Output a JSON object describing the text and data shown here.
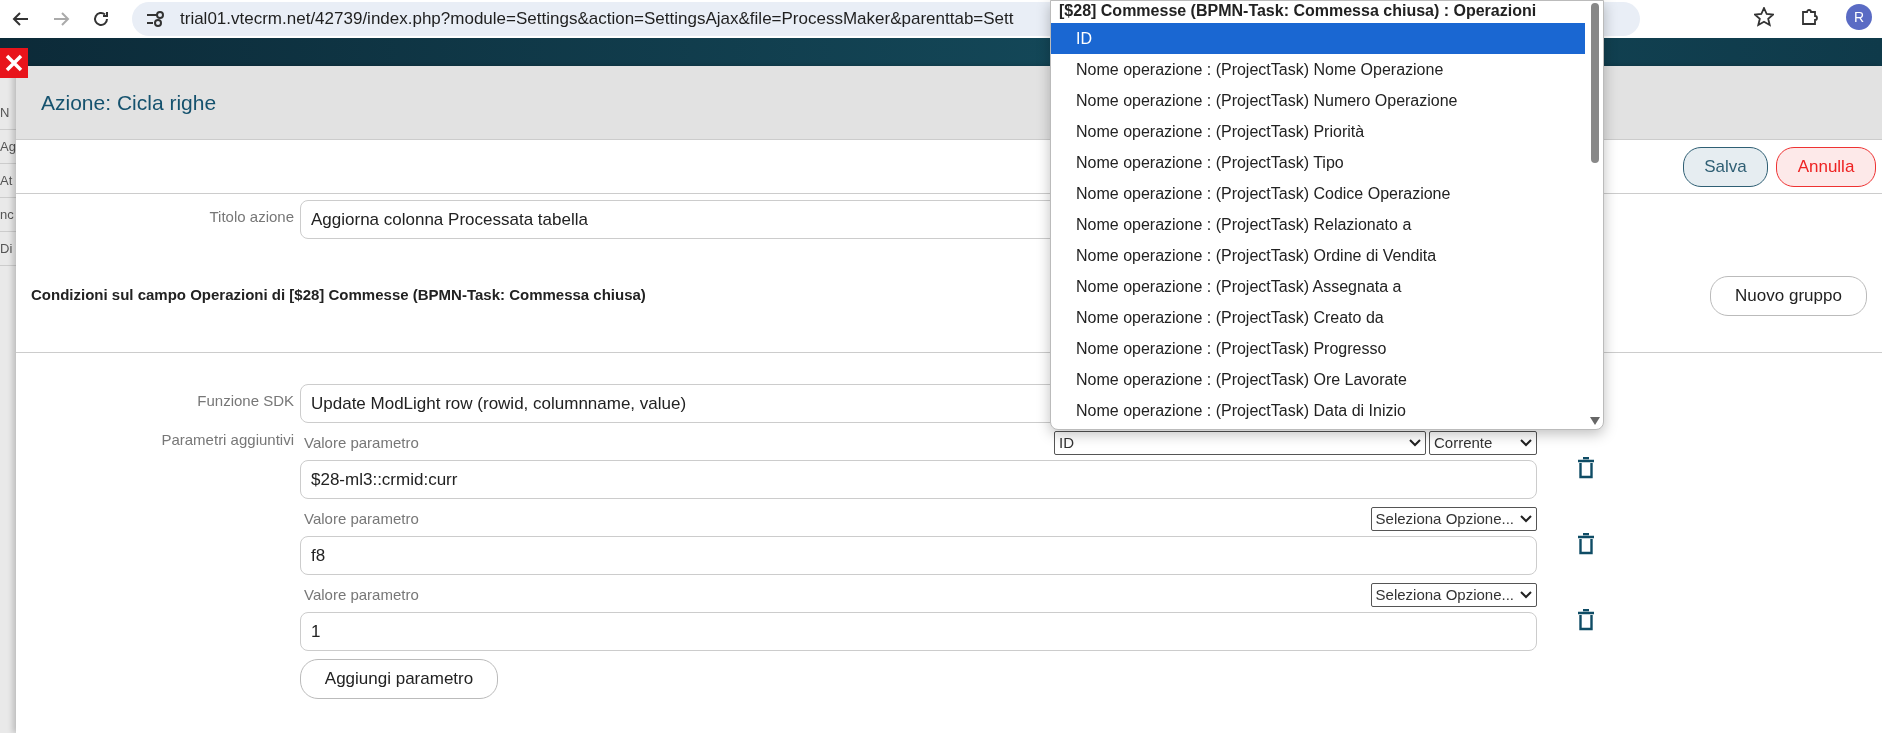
{
  "browser": {
    "url": "trial01.vtecrm.net/42739/index.php?module=Settings&action=SettingsAjax&file=ProcessMaker&parenttab=Sett",
    "avatar": "R"
  },
  "background_fragments": [
    "N",
    "Ag",
    "At",
    "nc",
    "Di"
  ],
  "modal": {
    "title": "Azione: Cicla righe",
    "buttons": [
      {
        "label": "Salva",
        "kind": "save"
      },
      {
        "label": "Annulla",
        "kind": "cancel"
      }
    ],
    "action_title": {
      "label": "Titolo azione",
      "value": "Aggiorna colonna Processata tabella"
    },
    "conditions": {
      "text": "Condizioni sul campo Operazioni di [$28] Commesse (BPMN-Task: Commessa chiusa)",
      "button": "Nuovo gruppo"
    },
    "sdk_function": {
      "label": "Funzione SDK",
      "value": "Update ModLight row (rowid, columnname, value)"
    },
    "parameters": {
      "label": "Parametri aggiuntivi",
      "add_button": "Aggiungi parametro",
      "items": [
        {
          "label": "Valore parametro",
          "value": "$28-ml3::crmid:curr",
          "selects": [
            "ID",
            "Corrente"
          ]
        },
        {
          "label": "Valore parametro",
          "value": "f8",
          "selects": [
            "Seleziona Opzione..."
          ]
        },
        {
          "label": "Valore parametro",
          "value": "1",
          "selects": [
            "Seleziona Opzione..."
          ]
        }
      ]
    }
  },
  "dropdown": {
    "group": "[$28] Commesse (BPMN-Task: Commessa chiusa) : Operazioni",
    "options": [
      {
        "label": "ID",
        "selected": true
      },
      {
        "label": "Nome operazione : (ProjectTask) Nome Operazione",
        "selected": false
      },
      {
        "label": "Nome operazione : (ProjectTask) Numero Operazione",
        "selected": false
      },
      {
        "label": "Nome operazione : (ProjectTask) Priorità",
        "selected": false
      },
      {
        "label": "Nome operazione : (ProjectTask) Tipo",
        "selected": false
      },
      {
        "label": "Nome operazione : (ProjectTask) Codice Operazione",
        "selected": false
      },
      {
        "label": "Nome operazione : (ProjectTask) Relazionato a",
        "selected": false
      },
      {
        "label": "Nome operazione : (ProjectTask) Ordine di Vendita",
        "selected": false
      },
      {
        "label": "Nome operazione : (ProjectTask) Assegnata a",
        "selected": false
      },
      {
        "label": "Nome operazione : (ProjectTask) Creato da",
        "selected": false
      },
      {
        "label": "Nome operazione : (ProjectTask) Progresso",
        "selected": false
      },
      {
        "label": "Nome operazione : (ProjectTask) Ore Lavorate",
        "selected": false
      },
      {
        "label": "Nome operazione : (ProjectTask) Data di Inizio",
        "selected": false
      }
    ]
  }
}
